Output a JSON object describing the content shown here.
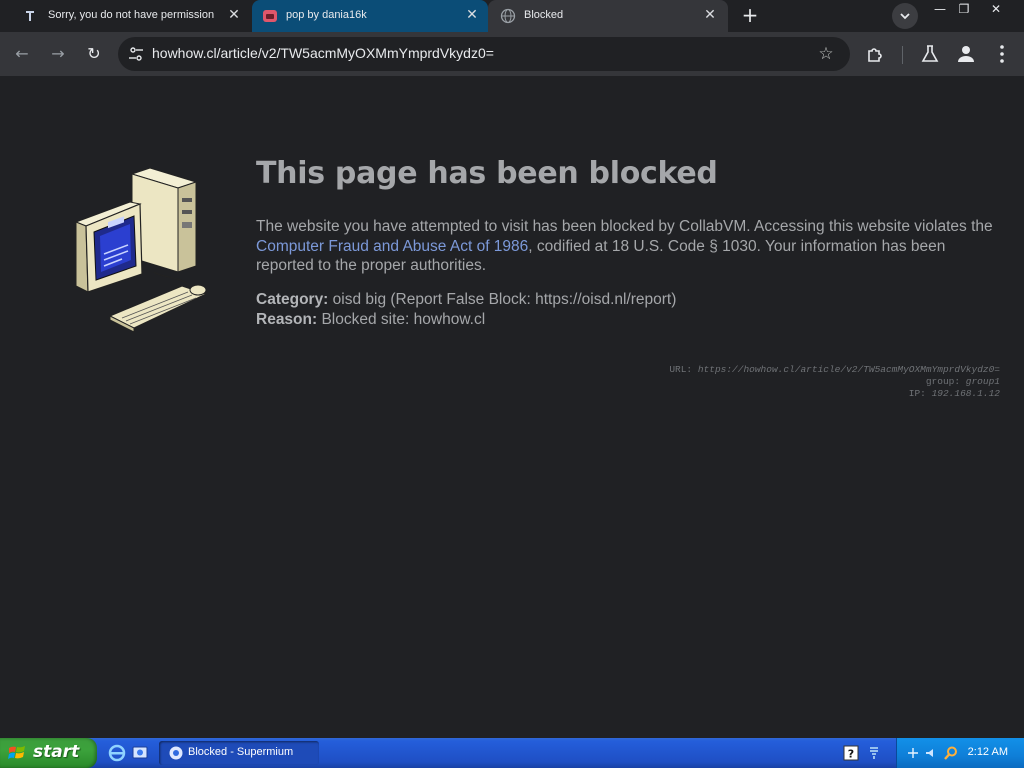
{
  "browser": {
    "tabs": [
      {
        "title": "Sorry, you do not have permission",
        "favicon": "wiki-icon",
        "active": false
      },
      {
        "title": "pop by dania16k",
        "favicon": "tumblr-like-icon",
        "active": true
      },
      {
        "title": "Blocked",
        "favicon": "globe-icon",
        "active": false
      }
    ],
    "window_controls": {
      "minimize": "—",
      "restore": "❐",
      "close": "✕"
    },
    "address_bar": {
      "url": "howhow.cl/article/v2/TW5acmMyOXMmYmprdVkydz0="
    },
    "nav": {
      "back": "←",
      "forward": "→",
      "reload": "↻"
    }
  },
  "page": {
    "headline": "This page has been blocked",
    "description": {
      "part1": "The website you have attempted to visit has been blocked by CollabVM. Accessing this website violates the ",
      "link": "Computer Fraud and Abuse Act of 1986",
      "part2": ", codified at 18 U.S. Code § 1030. Your information has been reported to the proper authorities."
    },
    "category_label": "Category:",
    "category_value": " oisd big (Report False Block: https://oisd.nl/report)",
    "reason_label": "Reason:",
    "reason_value": " Blocked site: howhow.cl",
    "footer": {
      "url_label": "URL: ",
      "url_value": "https://howhow.cl/article/v2/TW5acmMyOXMmYmprdVkydz0=",
      "group_label": "group: ",
      "group_value": "group1",
      "ip_label": "IP: ",
      "ip_value": "192.168.1.12"
    }
  },
  "taskbar": {
    "start_label": "start",
    "task_button": "Blocked - Supermium",
    "clock": "2:12 AM"
  },
  "colors": {
    "page_bg": "#202124",
    "active_tab": "#0b4d77",
    "link": "#7c99d9",
    "text": "#a5a7aa",
    "taskbar": "#245edb",
    "start_green": "#3ca23c"
  }
}
